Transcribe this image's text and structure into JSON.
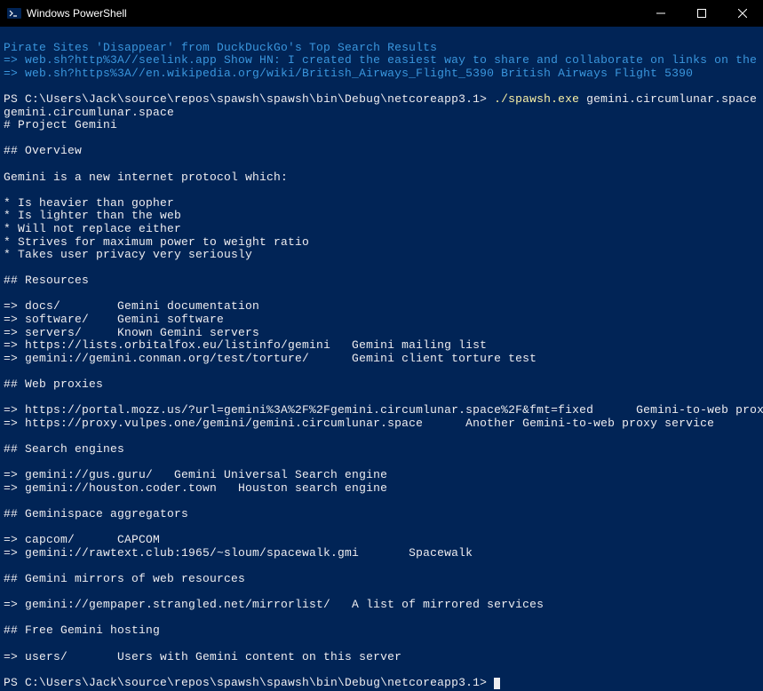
{
  "window": {
    "title": "Windows PowerShell"
  },
  "lines": {
    "l0": "Pirate Sites 'Disappear' from DuckDuckGo's Top Search Results",
    "l1": "=> web.sh?http%3A//seelink.app Show HN: I created the easiest way to share and collaborate on links on the web",
    "l2": "=> web.sh?https%3A//en.wikipedia.org/wiki/British_Airways_Flight_5390 British Airways Flight 5390",
    "l3": "",
    "prompt1_a": "PS C:\\Users\\Jack\\source\\repos\\spawsh\\spawsh\\bin\\Debug\\netcoreapp3.1> ",
    "prompt1_b": "./spawsh.exe",
    "prompt1_c": " gemini.circumlunar.space",
    "l5": "gemini.circumlunar.space",
    "l6": "# Project Gemini",
    "l7": "",
    "l8": "## Overview",
    "l9": "",
    "l10": "Gemini is a new internet protocol which:",
    "l11": "",
    "l12": "* Is heavier than gopher",
    "l13": "* Is lighter than the web",
    "l14": "* Will not replace either",
    "l15": "* Strives for maximum power to weight ratio",
    "l16": "* Takes user privacy very seriously",
    "l17": "",
    "l18": "## Resources",
    "l19": "",
    "l20": "=> docs/        Gemini documentation",
    "l21": "=> software/    Gemini software",
    "l22": "=> servers/     Known Gemini servers",
    "l23": "=> https://lists.orbitalfox.eu/listinfo/gemini   Gemini mailing list",
    "l24": "=> gemini://gemini.conman.org/test/torture/      Gemini client torture test",
    "l25": "",
    "l26": "## Web proxies",
    "l27": "",
    "l28": "=> https://portal.mozz.us/?url=gemini%3A%2F%2Fgemini.circumlunar.space%2F&fmt=fixed      Gemini-to-web proxy service",
    "l29": "=> https://proxy.vulpes.one/gemini/gemini.circumlunar.space      Another Gemini-to-web proxy service",
    "l30": "",
    "l31": "## Search engines",
    "l32": "",
    "l33": "=> gemini://gus.guru/   Gemini Universal Search engine",
    "l34": "=> gemini://houston.coder.town   Houston search engine",
    "l35": "",
    "l36": "## Geminispace aggregators",
    "l37": "",
    "l38": "=> capcom/      CAPCOM",
    "l39": "=> gemini://rawtext.club:1965/~sloum/spacewalk.gmi       Spacewalk",
    "l40": "",
    "l41": "## Gemini mirrors of web resources",
    "l42": "",
    "l43": "=> gemini://gempaper.strangled.net/mirrorlist/   A list of mirrored services",
    "l44": "",
    "l45": "## Free Gemini hosting",
    "l46": "",
    "l47": "=> users/       Users with Gemini content on this server",
    "l48": "",
    "prompt2": "PS C:\\Users\\Jack\\source\\repos\\spawsh\\spawsh\\bin\\Debug\\netcoreapp3.1> "
  }
}
